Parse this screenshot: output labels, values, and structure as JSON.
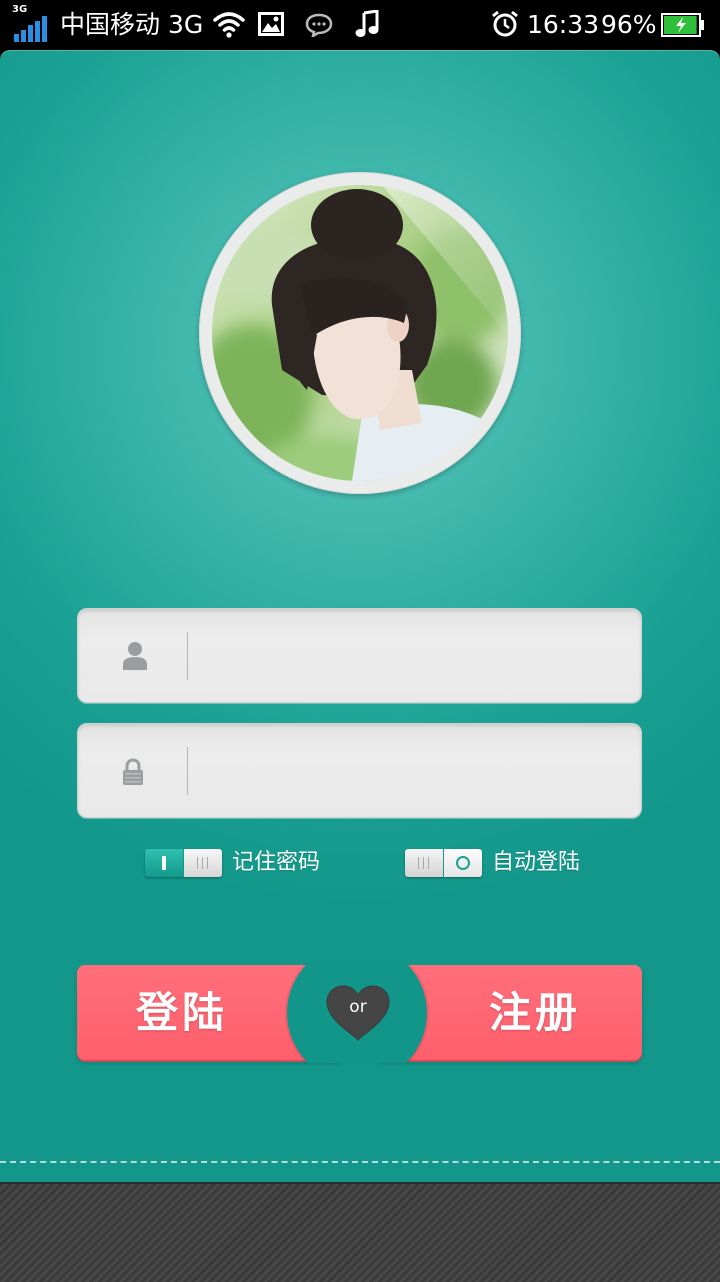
{
  "status_bar": {
    "network_badge": "3G",
    "signal_bars": 5,
    "carrier": "中国移动 3G",
    "time": "16:33",
    "battery_percent": "96%",
    "battery_level": 0.96,
    "icons": [
      "signal-icon",
      "wifi-icon",
      "gallery-icon",
      "chat-icon",
      "music-icon",
      "alarm-icon",
      "battery-icon"
    ]
  },
  "login_form": {
    "username": {
      "icon": "user-icon"
    },
    "password": {
      "icon": "lock-icon"
    }
  },
  "options": {
    "remember_password": {
      "label": "记住密码",
      "enabled": true
    },
    "auto_login": {
      "label": "自动登陆",
      "enabled": false
    }
  },
  "actions": {
    "login_label": "登陆",
    "or_label": "or",
    "register_label": "注册"
  },
  "colors": {
    "primary_teal": "#16a092",
    "button_pink": "#ff6672",
    "heart_gray": "#454545",
    "battery_green": "#2fbf3a",
    "signal_blue": "#2a8fe2"
  }
}
